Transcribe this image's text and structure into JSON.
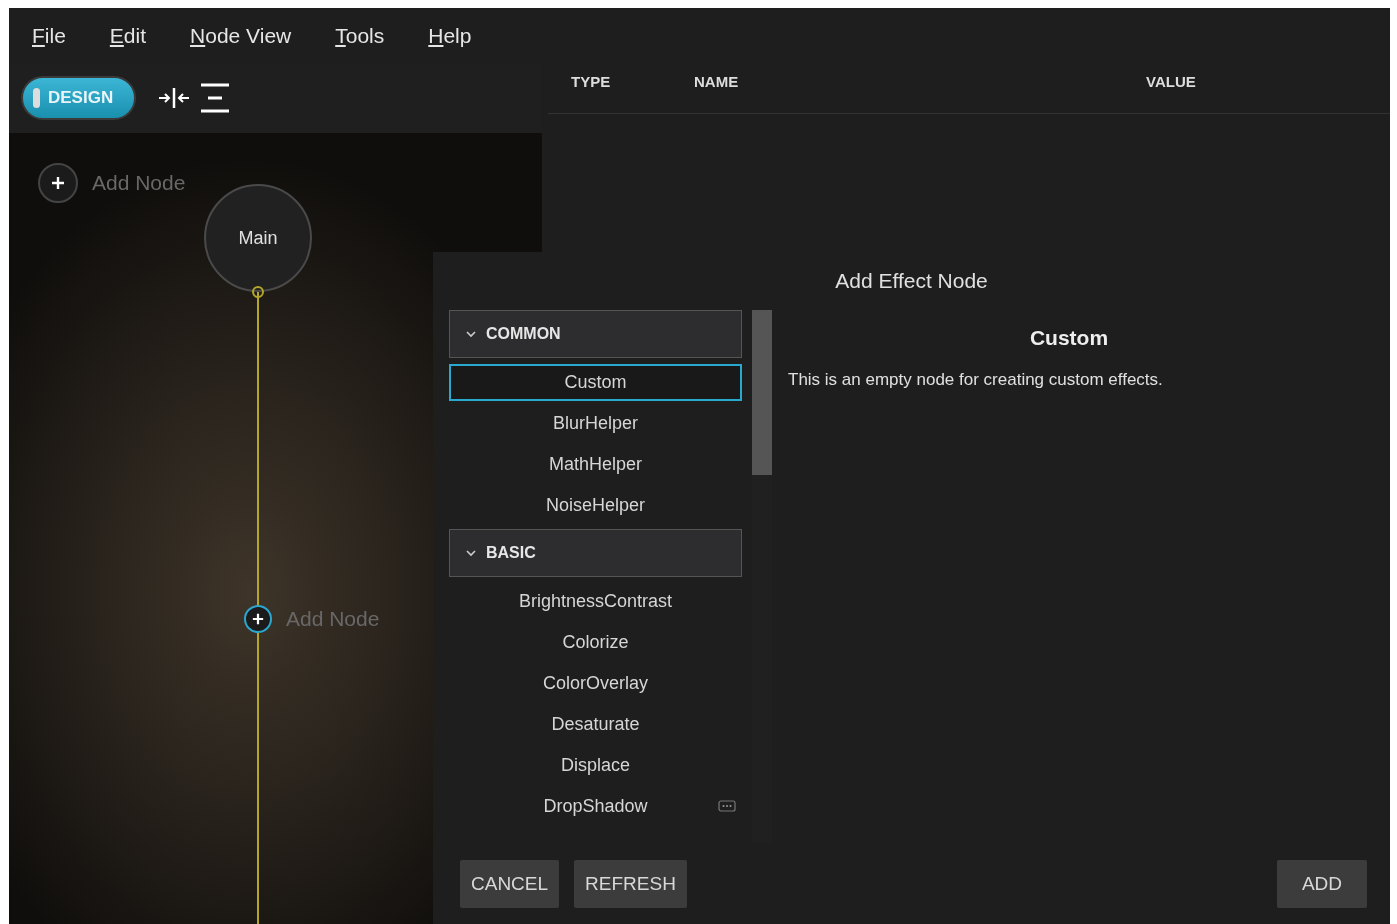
{
  "menu": [
    {
      "label": "File"
    },
    {
      "label": "Edit"
    },
    {
      "label": "Node View"
    },
    {
      "label": "Tools"
    },
    {
      "label": "Help"
    }
  ],
  "toolbar": {
    "mode_toggle": {
      "label": "DESIGN",
      "on": true
    }
  },
  "canvas": {
    "add_buttons": [
      {
        "label": "Add Node",
        "highlighted": false
      },
      {
        "label": "Add Node",
        "highlighted": true
      }
    ],
    "main_node": {
      "label": "Main"
    }
  },
  "properties_table": {
    "columns": [
      "TYPE",
      "NAME",
      "VALUE"
    ]
  },
  "dialog": {
    "title": "Add Effect Node",
    "categories": [
      {
        "label": "COMMON",
        "expanded": true,
        "items": [
          {
            "label": "Custom",
            "selected": true,
            "hover": false
          },
          {
            "label": "BlurHelper",
            "selected": false,
            "hover": false
          },
          {
            "label": "MathHelper",
            "selected": false,
            "hover": false
          },
          {
            "label": "NoiseHelper",
            "selected": false,
            "hover": false
          }
        ]
      },
      {
        "label": "BASIC",
        "expanded": true,
        "items": [
          {
            "label": "BrightnessContrast",
            "selected": false,
            "hover": false
          },
          {
            "label": "Colorize",
            "selected": false,
            "hover": false
          },
          {
            "label": "ColorOverlay",
            "selected": false,
            "hover": false
          },
          {
            "label": "Desaturate",
            "selected": false,
            "hover": false
          },
          {
            "label": "Displace",
            "selected": false,
            "hover": false
          },
          {
            "label": "DropShadow",
            "selected": false,
            "hover": true
          }
        ]
      }
    ],
    "detail": {
      "title": "Custom",
      "description": "This is an empty node for creating custom effects."
    },
    "buttons": {
      "cancel": "CANCEL",
      "refresh": "REFRESH",
      "add": "ADD"
    }
  }
}
